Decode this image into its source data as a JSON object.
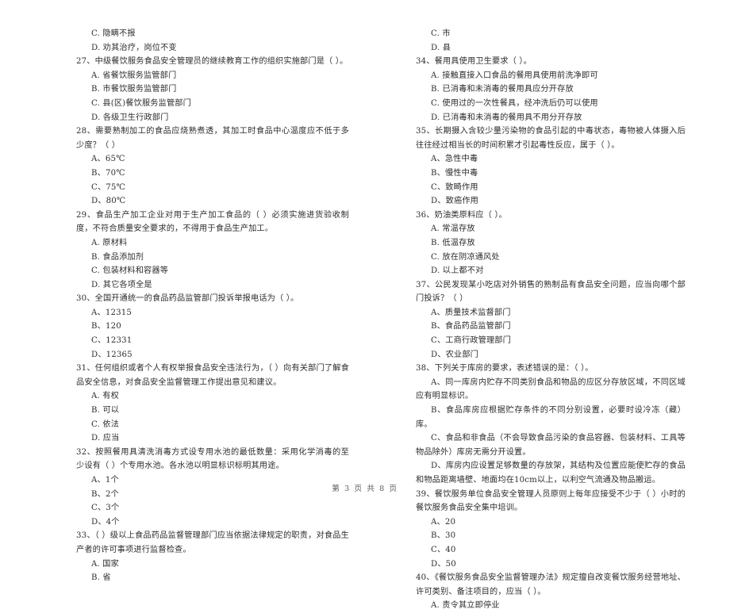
{
  "document": {
    "page_footer": "第 3 页 共 8 页"
  },
  "left_column": {
    "items": [
      {
        "type": "option",
        "text": "C. 隐瞒不报"
      },
      {
        "type": "option",
        "text": "D. 劝其治疗，岗位不变"
      },
      {
        "type": "question",
        "text": "27、中级餐饮服务食品安全管理员的继续教育工作的组织实施部门是（     ）。"
      },
      {
        "type": "option",
        "text": "A. 省餐饮服务监管部门"
      },
      {
        "type": "option",
        "text": "B. 市餐饮服务监管部门"
      },
      {
        "type": "option",
        "text": "C. 县(区)餐饮服务监管部门"
      },
      {
        "type": "option",
        "text": "D. 各级卫生行政部门"
      },
      {
        "type": "question",
        "text": "28、需要熟制加工的食品应烧熟煮透，其加工时食品中心温度应不低于多少度？（     ）"
      },
      {
        "type": "option",
        "text": "A、65℃"
      },
      {
        "type": "option",
        "text": "B、70℃"
      },
      {
        "type": "option",
        "text": "C、75℃"
      },
      {
        "type": "option",
        "text": "D、80℃"
      },
      {
        "type": "question",
        "text": "29、食品生产加工企业对用于生产加工食品的（     ）必须实施进货验收制度，不符合质量安全要求的，不得用于食品生产加工。"
      },
      {
        "type": "option",
        "text": "A. 原材料"
      },
      {
        "type": "option",
        "text": "B. 食品添加剂"
      },
      {
        "type": "option",
        "text": "C. 包装材料和容器等"
      },
      {
        "type": "option",
        "text": "D. 其它各项全是"
      },
      {
        "type": "question",
        "text": "30、全国开通统一的食品药品监管部门投诉举报电话为（     ）。"
      },
      {
        "type": "option",
        "text": "A、12315"
      },
      {
        "type": "option",
        "text": "B、120"
      },
      {
        "type": "option",
        "text": "C、12331"
      },
      {
        "type": "option",
        "text": "D、12365"
      },
      {
        "type": "question",
        "text": "31、任何组织或者个人有权举报食品安全违法行为，（     ）向有关部门了解食品安全信息，对食品安全监督管理工作提出意见和建议。"
      },
      {
        "type": "option",
        "text": "A. 有权"
      },
      {
        "type": "option",
        "text": "B. 可以"
      },
      {
        "type": "option",
        "text": "C. 依法"
      },
      {
        "type": "option",
        "text": "D. 应当"
      },
      {
        "type": "question",
        "text": "32、按照餐用具清洗消毒方式设专用水池的最低数量：采用化学消毒的至少设有（     ）个专用水池。各水池以明显标识标明其用途。"
      },
      {
        "type": "option",
        "text": "A、1个"
      },
      {
        "type": "option",
        "text": "B、2个"
      },
      {
        "type": "option",
        "text": "C、3个"
      },
      {
        "type": "option",
        "text": "D、4个"
      },
      {
        "type": "question",
        "text": "33、（     ）级以上食品药品监督管理部门应当依据法律规定的职责，对食品生产者的许可事项进行监督检查。"
      },
      {
        "type": "option",
        "text": "A. 国家"
      },
      {
        "type": "option",
        "text": "B. 省"
      }
    ]
  },
  "right_column": {
    "items": [
      {
        "type": "option",
        "text": "C. 市"
      },
      {
        "type": "option",
        "text": "D. 县"
      },
      {
        "type": "question",
        "text": "34、餐用具使用卫生要求（     ）。"
      },
      {
        "type": "option",
        "text": "A. 接触直接入口食品的餐用具使用前洗净即可"
      },
      {
        "type": "option",
        "text": "B. 已消毒和未消毒的餐用具应分开存放"
      },
      {
        "type": "option",
        "text": "C. 使用过的一次性餐具，经冲洗后仍可以使用"
      },
      {
        "type": "option",
        "text": "D. 已消毒和未消毒的餐用具不用分开存放"
      },
      {
        "type": "question",
        "text": "35、长期摄入含较少量污染物的食品引起的中毒状态，毒物被人体摄入后往往经过相当长的时间积累才引起毒性反应，属于（     ）。"
      },
      {
        "type": "option",
        "text": "A、急性中毒"
      },
      {
        "type": "option",
        "text": "B、慢性中毒"
      },
      {
        "type": "option",
        "text": "C、致畸作用"
      },
      {
        "type": "option",
        "text": "D、致癌作用"
      },
      {
        "type": "question",
        "text": "36、奶油类原料应（     ）。"
      },
      {
        "type": "option",
        "text": "A. 常温存放"
      },
      {
        "type": "option",
        "text": "B. 低温存放"
      },
      {
        "type": "option",
        "text": "C. 放在阴凉通风处"
      },
      {
        "type": "option",
        "text": "D. 以上都不对"
      },
      {
        "type": "question",
        "text": "37、公民发现某小吃店对外销售的熟制品有食品安全问题，应当向哪个部门投诉？（     ）"
      },
      {
        "type": "option",
        "text": "A、质量技术监督部门"
      },
      {
        "type": "option",
        "text": "B、食品药品监管部门"
      },
      {
        "type": "option",
        "text": "C、工商行政管理部门"
      },
      {
        "type": "option",
        "text": "D、农业部门"
      },
      {
        "type": "question",
        "text": "38、下列关于库房的要求，表述错误的是：（     ）。"
      },
      {
        "type": "option_wrap",
        "text": "A、同一库房内贮存不同类别食品和物品的应区分存放区域，不同区域应有明显标识。"
      },
      {
        "type": "option_wrap",
        "text": "B、食品库房应根据贮存条件的不同分别设置，必要时设冷冻（藏）库。"
      },
      {
        "type": "option_wrap",
        "text": "C、食品和非食品（不会导致食品污染的食品容器、包装材料、工具等物品除外）库房无需分开设置。"
      },
      {
        "type": "option_wrap",
        "text": "D、库房内应设置足够数量的存放架，其结构及位置应能使贮存的食品和物品距离墙壁、地面均在10cm以上，以利空气流通及物品搬运。"
      },
      {
        "type": "question",
        "text": "39、餐饮服务单位食品安全管理人员原则上每年应接受不少于（     ）小时的餐饮服务食品安全集中培训。"
      },
      {
        "type": "option",
        "text": "A、20"
      },
      {
        "type": "option",
        "text": "B、30"
      },
      {
        "type": "option",
        "text": "C、40"
      },
      {
        "type": "option",
        "text": "D、50"
      },
      {
        "type": "question",
        "text": "40、《餐饮服务食品安全监督管理办法》规定擅自改变餐饮服务经营地址、许可类别、备注项目的，应当（     ）。"
      },
      {
        "type": "option",
        "text": "A. 责令其立即停业"
      }
    ]
  }
}
